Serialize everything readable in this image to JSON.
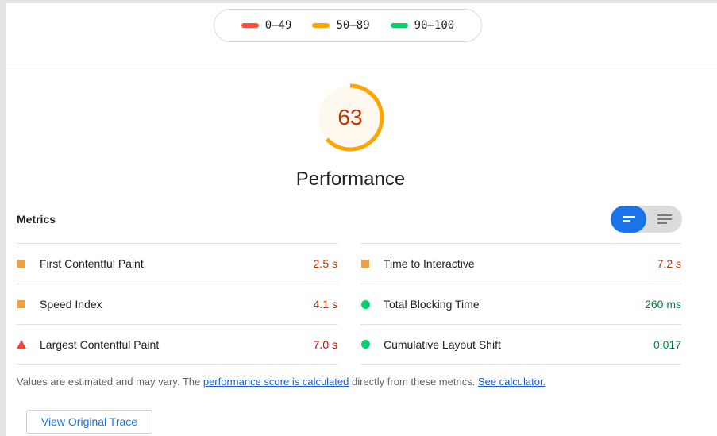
{
  "legend": {
    "items": [
      {
        "label": "0–49",
        "color": "#ff4e42"
      },
      {
        "label": "50–89",
        "color": "#ffa400"
      },
      {
        "label": "90–100",
        "color": "#0cce6b"
      }
    ]
  },
  "score": {
    "value": "63",
    "score_fraction": 0.63,
    "color": "#ffa400",
    "title": "Performance"
  },
  "metrics": {
    "title": "Metrics",
    "toggle": {
      "active": "expanded-view",
      "options": [
        "expanded-view-icon",
        "collapsed-view-icon"
      ]
    },
    "left": [
      {
        "label": "First Contentful Paint",
        "value": "2.5 s",
        "status": "average",
        "icon": "orange-square-icon"
      },
      {
        "label": "Speed Index",
        "value": "4.1 s",
        "status": "average",
        "icon": "orange-square-icon"
      },
      {
        "label": "Largest Contentful Paint",
        "value": "7.0 s",
        "status": "fail",
        "icon": "red-triangle-icon"
      }
    ],
    "right": [
      {
        "label": "Time to Interactive",
        "value": "7.2 s",
        "status": "average",
        "icon": "orange-square-icon"
      },
      {
        "label": "Total Blocking Time",
        "value": "260 ms",
        "status": "pass",
        "icon": "green-circle-icon"
      },
      {
        "label": "Cumulative Layout Shift",
        "value": "0.017",
        "status": "pass",
        "icon": "green-circle-icon"
      }
    ]
  },
  "note": {
    "prefix": "Values are estimated and may vary. The ",
    "link1": "performance score is calculated",
    "middle": " directly from these metrics. ",
    "link2": "See calculator."
  },
  "trace_button": "View Original Trace"
}
